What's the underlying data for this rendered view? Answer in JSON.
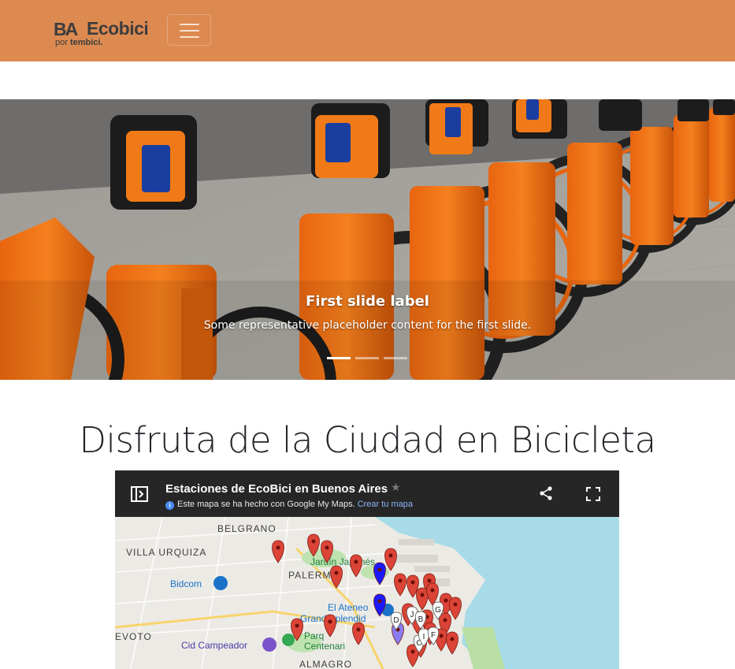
{
  "navbar": {
    "brand_ba": "BA",
    "brand_name": "Ecobici",
    "brand_por": "por",
    "brand_tembici": "tembici."
  },
  "carousel": {
    "slide_label": "First slide label",
    "slide_text": "Some representative placeholder content for the first slide.",
    "indicators": 3,
    "active_index": 0
  },
  "page": {
    "title": "Disfruta de la Ciudad en Bicicleta"
  },
  "map": {
    "title": "Estaciones de EcoBici en Buenos Aires",
    "subtitle": "Este mapa se ha hecho con Google My Maps.",
    "subtitle_link": "Crear tu mapa",
    "labels": {
      "belgrano": "BELGRANO",
      "villa_urquiza": "VILLA URQUIZA",
      "palermo": "PALERMO",
      "jardin": "Jardín Japonés",
      "bidcom": "Bidcom",
      "el_ateneo": "El Ateneo",
      "grand_splendid": "Grand Splendid",
      "devoto": "EVOTO",
      "cid_campeador": "Cid Campeador",
      "parque_1": "Parq",
      "parque_2": "Centenari",
      "almagro": "ALMAGRO"
    },
    "marker_letters": [
      "D",
      "J",
      "B",
      "G",
      "C",
      "I",
      "F"
    ],
    "colors": {
      "header_bg": "#262626",
      "marker_red": "#db4437",
      "marker_blue": "#1a1aff",
      "water": "#a8dbe8",
      "land": "#eceae5"
    }
  },
  "colors": {
    "navbar": "#dd8a51"
  }
}
